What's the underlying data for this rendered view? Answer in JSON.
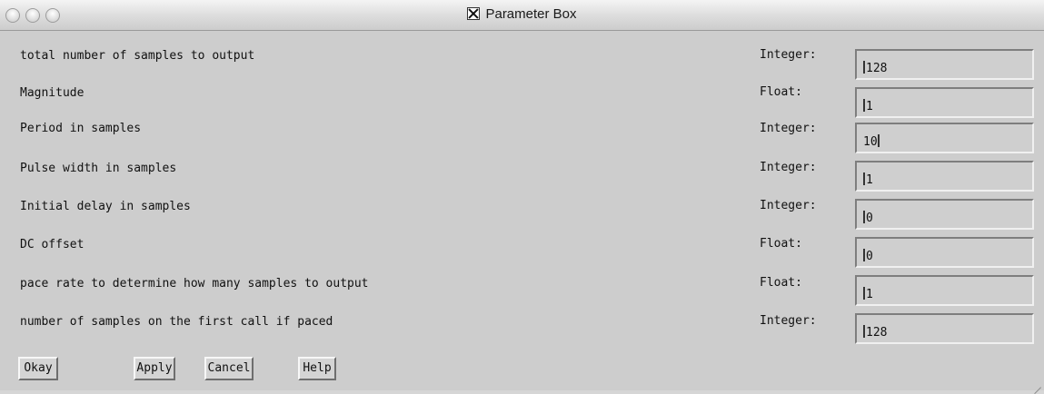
{
  "window": {
    "title": "Parameter Box"
  },
  "params": [
    {
      "label": "total number of samples to output",
      "type": "Integer:",
      "value": "128"
    },
    {
      "label": "Magnitude",
      "type": "Float:",
      "value": "1"
    },
    {
      "label": "Period in samples",
      "type": "Integer:",
      "value": "10"
    },
    {
      "label": "Pulse width in samples",
      "type": "Integer:",
      "value": "1"
    },
    {
      "label": "Initial delay in samples",
      "type": "Integer:",
      "value": "0"
    },
    {
      "label": "DC offset",
      "type": "Float:",
      "value": "0"
    },
    {
      "label": "pace rate to determine how many samples to output",
      "type": "Float:",
      "value": "1"
    },
    {
      "label": "number of samples on the first call if paced",
      "type": "Integer:",
      "value": "128"
    }
  ],
  "buttons": {
    "okay": "Okay",
    "apply": "Apply",
    "cancel": "Cancel",
    "help": "Help"
  }
}
